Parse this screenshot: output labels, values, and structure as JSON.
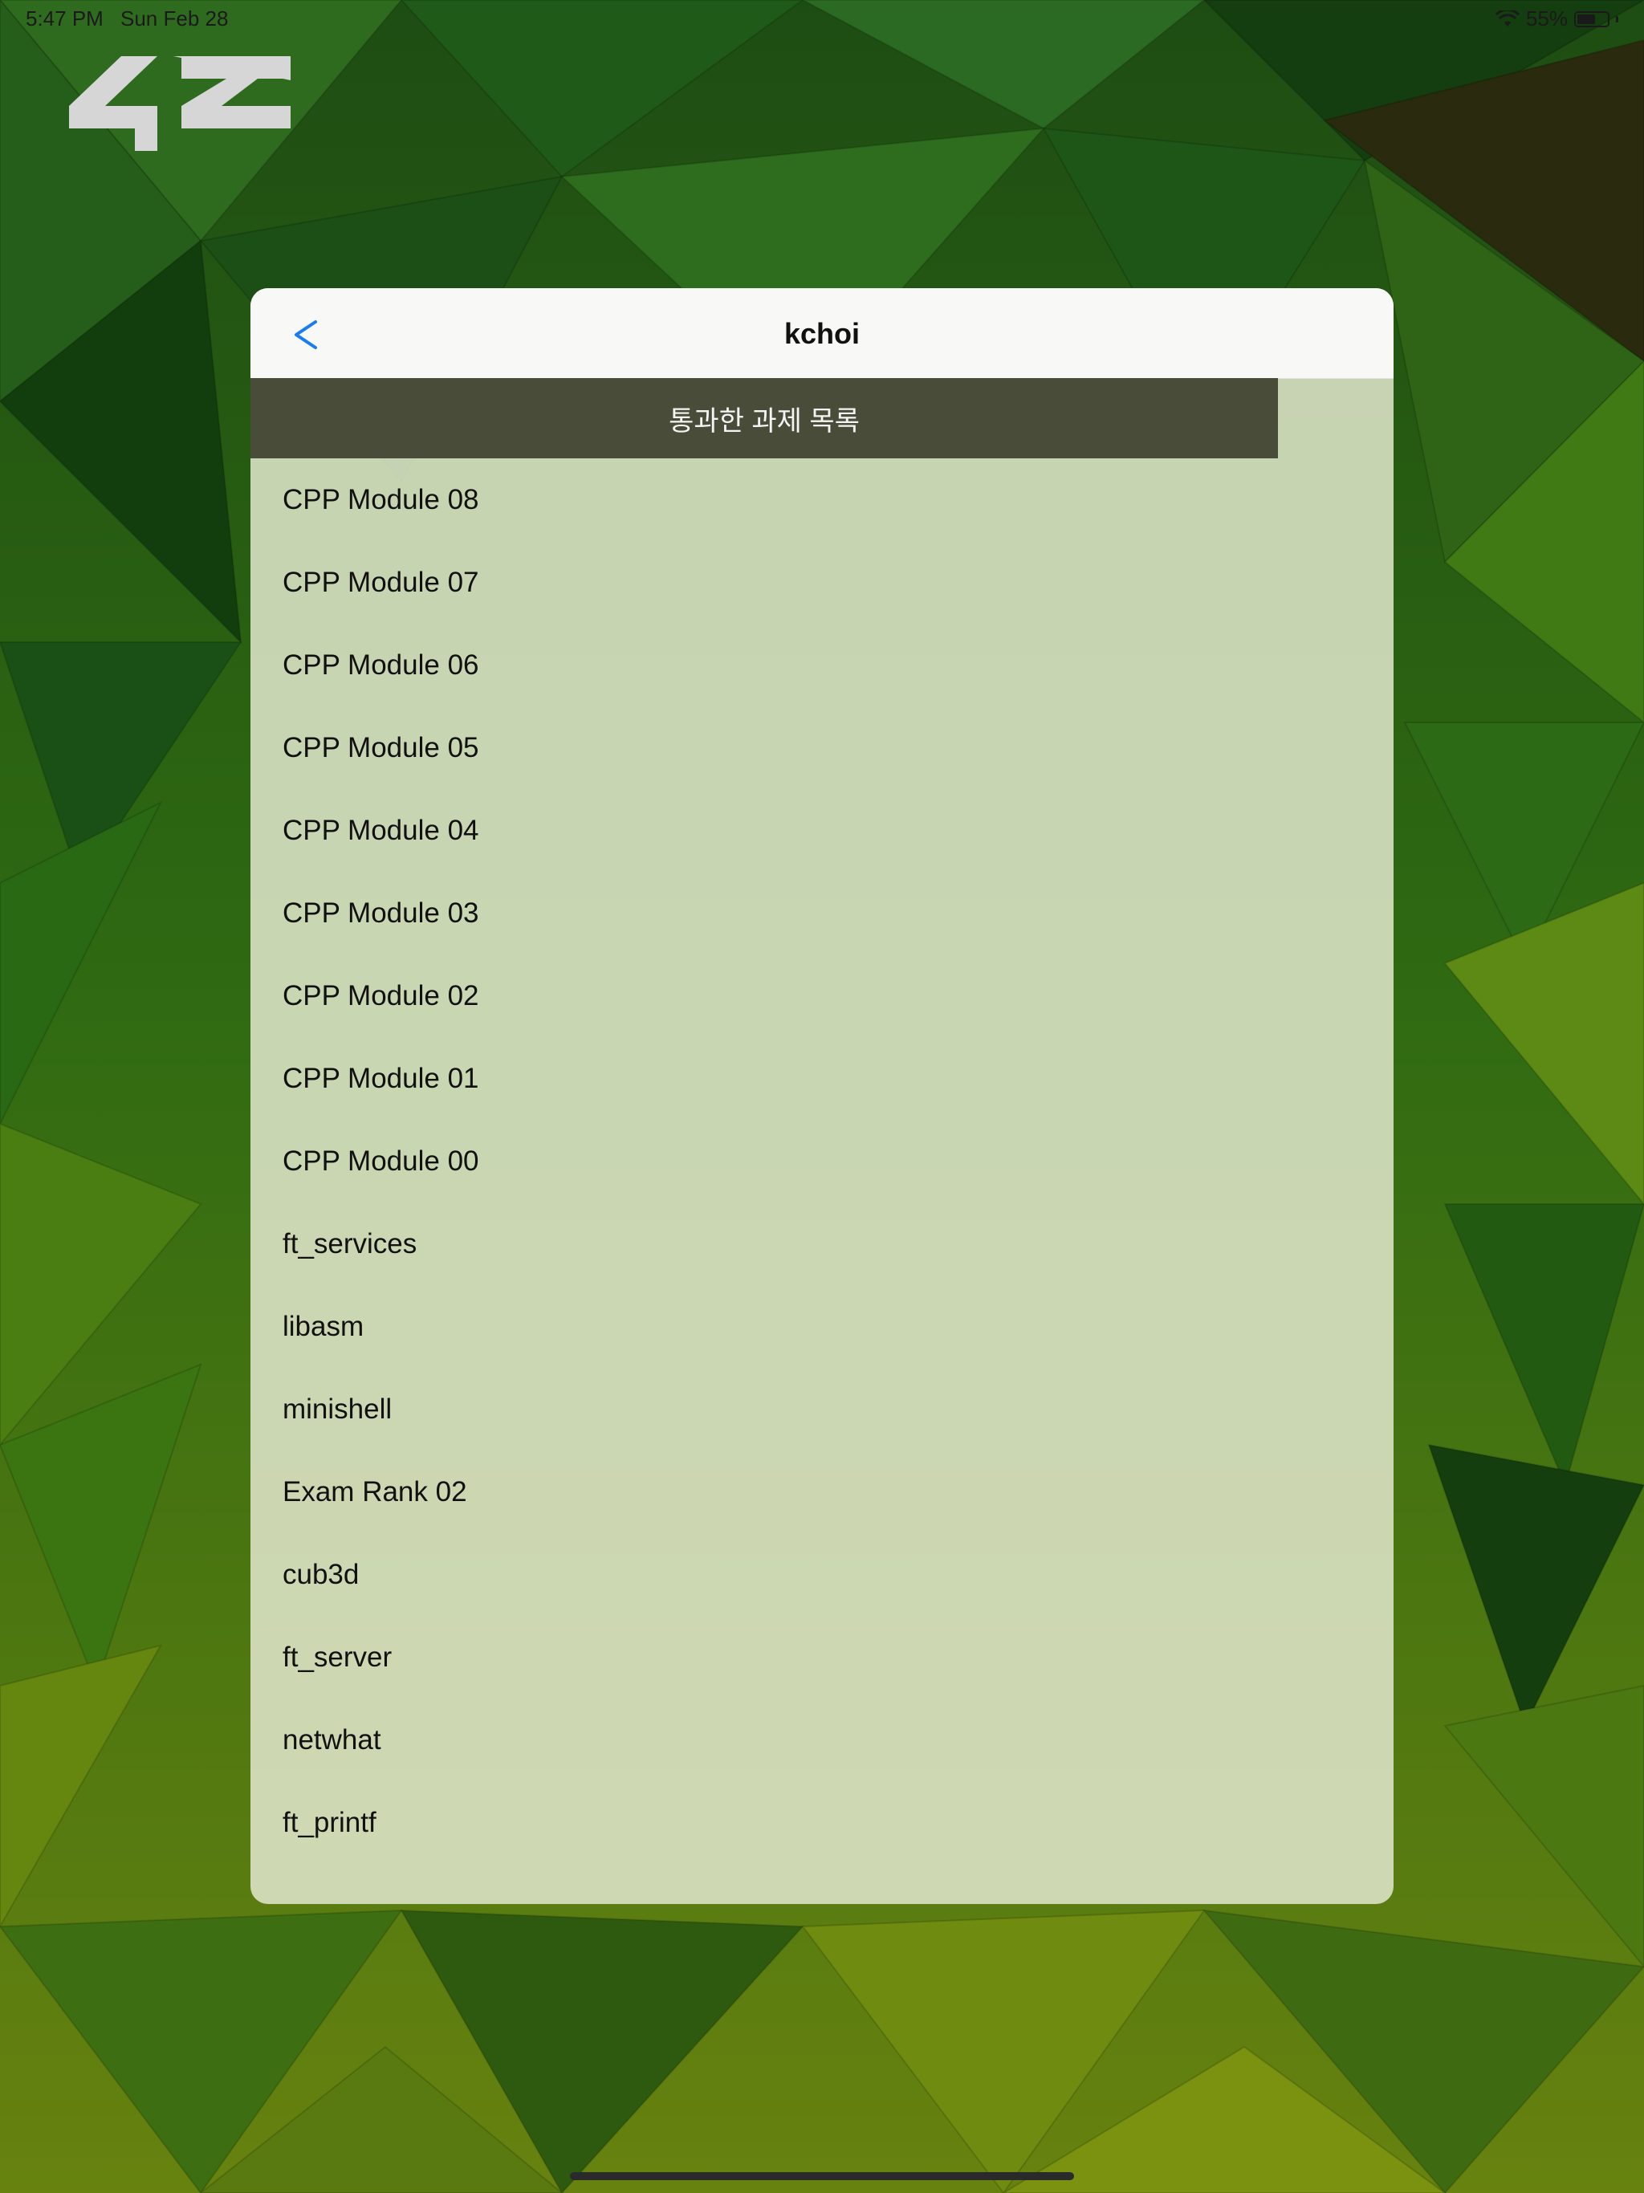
{
  "status_bar": {
    "time": "5:47 PM",
    "date": "Sun Feb 28",
    "battery": "55%",
    "battery_level": 0.55,
    "icons": [
      "wifi-icon",
      "battery-icon"
    ]
  },
  "logo": {
    "icon": "42-logo"
  },
  "header": {
    "back_icon": "chevron-left-icon",
    "title": "kchoi"
  },
  "section": {
    "title": "통과한 과제 목록"
  },
  "projects": [
    "CPP Module 08",
    "CPP Module 07",
    "CPP Module 06",
    "CPP Module 05",
    "CPP Module 04",
    "CPP Module 03",
    "CPP Module 02",
    "CPP Module 01",
    "CPP Module 00",
    "ft_services",
    "libasm",
    "minishell",
    "Exam Rank 02",
    "cub3d",
    "ft_server",
    "netwhat",
    "ft_printf"
  ],
  "colors": {
    "accent": "#1a7cf2",
    "section_bar": "#3e422e",
    "card_bg": "#e2e8cd",
    "background_dark": "#0f3a0e",
    "background_light": "#6b8f10"
  }
}
